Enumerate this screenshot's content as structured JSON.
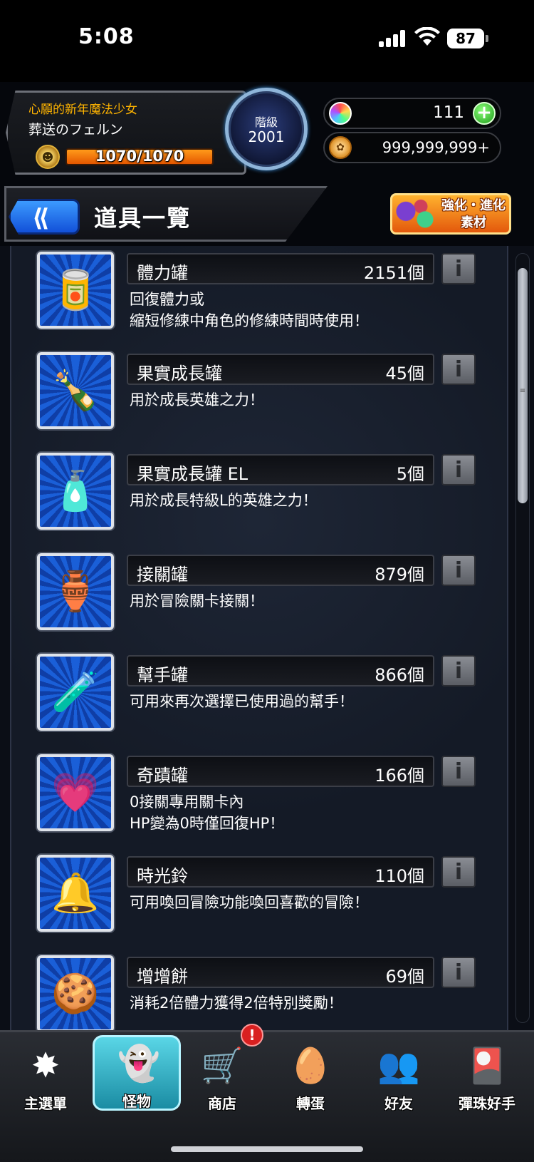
{
  "status_bar": {
    "time": "5:08",
    "battery": "87"
  },
  "player": {
    "subtitle": "心願的新年魔法少女",
    "name": "葬送のフェルン",
    "stamina": "1070/1070",
    "stamina_fraction": 1.0,
    "rank_label": "階級",
    "rank_value": "2001"
  },
  "currency": {
    "orbs": "111",
    "coins": "999,999,999+"
  },
  "title_bar": {
    "title": "道具一覽",
    "material_label_1": "強化・進化",
    "material_label_2": "素材"
  },
  "items": [
    {
      "name": "體力罐",
      "count": "2151個",
      "desc": "回復體力或\n縮短修練中角色的修練時間時使用！",
      "icon": "can-icon",
      "glyph": "🥫"
    },
    {
      "name": "果實成長罐",
      "count": "45個",
      "desc": "用於成長英雄之力！",
      "icon": "sprout-bottle-icon",
      "glyph": "🍾"
    },
    {
      "name": "果實成長罐 EL",
      "count": "5個",
      "desc": "用於成長特級L的英雄之力！",
      "icon": "sprout-bottle-el-icon",
      "glyph": "🧴"
    },
    {
      "name": "接關罐",
      "count": "879個",
      "desc": "用於冒險關卡接關！",
      "icon": "continue-jar-icon",
      "glyph": "🏺"
    },
    {
      "name": "幫手罐",
      "count": "866個",
      "desc": "可用來再次選擇已使用過的幫手！",
      "icon": "helper-jar-icon",
      "glyph": "🧪"
    },
    {
      "name": "奇蹟罐",
      "count": "166個",
      "desc": "0接關專用關卡內\nHP變為0時僅回復HP！",
      "icon": "miracle-jar-icon",
      "glyph": "💗"
    },
    {
      "name": "時光鈴",
      "count": "110個",
      "desc": "可用喚回冒險功能喚回喜歡的冒險！",
      "icon": "bell-icon",
      "glyph": "🔔"
    },
    {
      "name": "增增餅",
      "count": "69個",
      "desc": "消耗2倍體力獲得2倍特別獎勵！",
      "icon": "cookie-icon",
      "glyph": "🍪"
    }
  ],
  "nav": {
    "tabs": [
      {
        "label": "主選單",
        "icon": "main-menu-icon",
        "glyph": "✸"
      },
      {
        "label": "怪物",
        "icon": "monster-icon",
        "glyph": "👻"
      },
      {
        "label": "商店",
        "icon": "cart-icon",
        "glyph": "🛒"
      },
      {
        "label": "轉蛋",
        "icon": "egg-icon",
        "glyph": "🥚"
      },
      {
        "label": "好友",
        "icon": "friends-icon",
        "glyph": "👥"
      },
      {
        "label": "彈珠好手",
        "icon": "marble-player-icon",
        "glyph": "🎴"
      }
    ],
    "shop_badge": "!"
  }
}
